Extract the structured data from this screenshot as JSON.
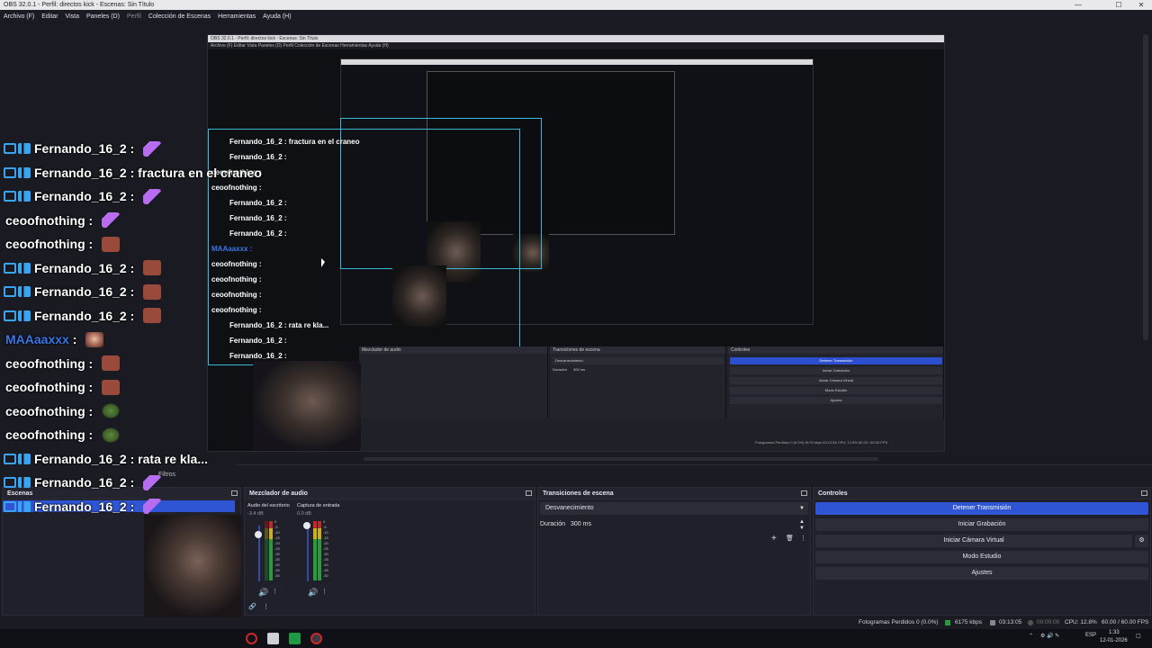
{
  "window": {
    "title": "OBS 32.0.1 - Perfil: directos kick - Escenas: Sin Título",
    "minimize": "—",
    "maximize": "☐",
    "close": "✕"
  },
  "menu": [
    {
      "label": "Archivo (F)"
    },
    {
      "label": "Editar"
    },
    {
      "label": "Vista"
    },
    {
      "label": "Paneles (D)"
    },
    {
      "label": "Perfil"
    },
    {
      "label": "Colección de Escenas"
    },
    {
      "label": "Herramientas"
    },
    {
      "label": "Ayuda (H)"
    }
  ],
  "chat": [
    {
      "user": "Fernando_16_2",
      "message": "",
      "user_color": "#ffffff",
      "emote": "purple",
      "badges": true
    },
    {
      "user": "Fernando_16_2",
      "message": "fractura en el craneo",
      "user_color": "#ffffff",
      "emote": "",
      "badges": true
    },
    {
      "user": "Fernando_16_2",
      "message": "",
      "user_color": "#ffffff",
      "emote": "purple",
      "badges": true
    },
    {
      "user": "ceoofnothing",
      "message": "",
      "user_color": "#ffffff",
      "emote": "purple",
      "badges": false
    },
    {
      "user": "ceoofnothing",
      "message": "",
      "user_color": "#ffffff",
      "emote": "red",
      "badges": false
    },
    {
      "user": "Fernando_16_2",
      "message": "",
      "user_color": "#ffffff",
      "emote": "red",
      "badges": true
    },
    {
      "user": "Fernando_16_2",
      "message": "",
      "user_color": "#ffffff",
      "emote": "red",
      "badges": true
    },
    {
      "user": "Fernando_16_2",
      "message": "",
      "user_color": "#ffffff",
      "emote": "red",
      "badges": true
    },
    {
      "user": "MAAaaxxx",
      "message": "",
      "user_color": "#3a76e8",
      "emote": "face",
      "badges": false
    },
    {
      "user": "ceoofnothing",
      "message": "",
      "user_color": "#ffffff",
      "emote": "red",
      "badges": false
    },
    {
      "user": "ceoofnothing",
      "message": "",
      "user_color": "#ffffff",
      "emote": "red",
      "badges": false
    },
    {
      "user": "ceoofnothing",
      "message": "",
      "user_color": "#ffffff",
      "emote": "green",
      "badges": false
    },
    {
      "user": "ceoofnothing",
      "message": "",
      "user_color": "#ffffff",
      "emote": "green",
      "badges": false
    },
    {
      "user": "Fernando_16_2",
      "message": "rata re kla...",
      "user_color": "#ffffff",
      "emote": "",
      "badges": true
    },
    {
      "user": "Fernando_16_2",
      "message": "",
      "user_color": "#ffffff",
      "emote": "purple",
      "badges": true
    },
    {
      "user": "Fernando_16_2",
      "message": "",
      "user_color": "#ffffff",
      "emote": "purple",
      "badges": true
    }
  ],
  "preview_chat": [
    {
      "text": "Fernando_16_2 : fractura en el craneo"
    },
    {
      "text": "Fernando_16_2 :"
    },
    {
      "text": "ceoofnothing :"
    },
    {
      "text": "ceoofnothing :"
    },
    {
      "text": "Fernando_16_2 :"
    },
    {
      "text": "Fernando_16_2 :"
    },
    {
      "text": "Fernando_16_2 :"
    },
    {
      "text": "MAAaaxxx :"
    },
    {
      "text": "ceoofnothing :"
    },
    {
      "text": "ceoofnothing :"
    },
    {
      "text": "ceoofnothing :"
    },
    {
      "text": "ceoofnothing :"
    },
    {
      "text": "Fernando_16_2 : rata re kla..."
    },
    {
      "text": "Fernando_16_2 :"
    },
    {
      "text": "Fernando_16_2 :"
    }
  ],
  "preview_inner": {
    "menu_text": "Archivo (F)   Editar   Vista   Paneles (D)   Perfil   Colección de Escenas   Herramientas   Ayuda (H)",
    "mixer_title": "Mezclador de audio",
    "transitions_title": "Transiciones de escena",
    "controls_title": "Controles",
    "transition_value": "Desvanecimiento",
    "duration_label": "Duración",
    "duration_value": "300 ms",
    "btns": [
      "Detener Transmisión",
      "Iniciar Grabación",
      "Iniciar Cámara Virtual",
      "Modo Estudio",
      "Ajustes"
    ],
    "status": "Fotogramas Perdidos 0 (0.0%)   6175 kbps   03:12:55   CPU: 12.8%   60.00 / 60.00 FPS"
  },
  "sources_bar": {
    "filters_label": "Filtros",
    "scenes_title": "Escenas"
  },
  "mixer": {
    "title": "Mezclador de audio",
    "channels": [
      {
        "name": "Audio del escritorio",
        "db": "-3.4 dB",
        "level": 0.55
      },
      {
        "name": "Captura de entrada",
        "db": "0.0 dB",
        "level": 0.6
      }
    ],
    "scale": [
      "0",
      "-5",
      "-10",
      "-15",
      "-20",
      "-25",
      "-30",
      "-35",
      "-40",
      "-45",
      "-50",
      "-55",
      "-60"
    ]
  },
  "transitions": {
    "title": "Transiciones de escena",
    "selected": "Desvanecimiento",
    "duration_label": "Duración",
    "duration_value": "300 ms",
    "add": "+",
    "remove": "🗑",
    "more": "⋮"
  },
  "controls": {
    "title": "Controles",
    "stop_stream": "Detener Transmisión",
    "start_recording": "Iniciar Grabación",
    "start_virtual_cam": "Iniciar Cámara Virtual",
    "studio_mode": "Modo Estudio",
    "settings": "Ajustes",
    "accent_color": "#2f55d4"
  },
  "status": {
    "dropped_frames": "Fotogramas Perdidos 0 (0.0%)",
    "bitrate": "6175 kbps",
    "stream_time": "03:13:05",
    "rec_time": "00:00:00",
    "cpu": "CPU: 12.8%",
    "fps": "60.00 / 60.00 FPS"
  },
  "taskbar": {
    "lang": "ESP",
    "time": "1:33",
    "date": "12-01-2026"
  }
}
